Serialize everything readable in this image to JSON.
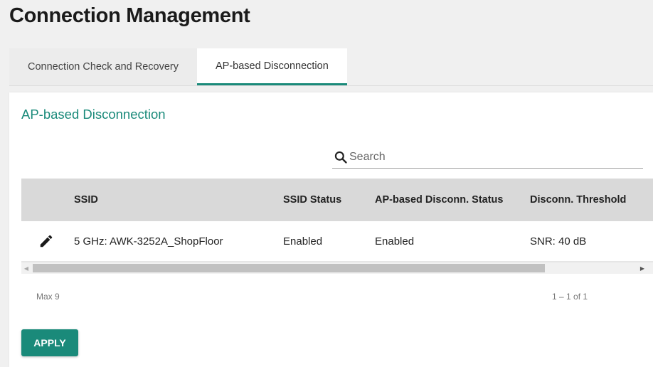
{
  "page": {
    "title": "Connection Management"
  },
  "tabs": [
    {
      "label": "Connection Check and Recovery",
      "active": false
    },
    {
      "label": "AP-based Disconnection",
      "active": true
    }
  ],
  "section": {
    "title": "AP-based Disconnection"
  },
  "search": {
    "placeholder": "Search",
    "icon": "search-icon"
  },
  "table": {
    "columns": [
      "",
      "SSID",
      "SSID Status",
      "AP-based Disconn. Status",
      "Disconn. Threshold"
    ],
    "rows": [
      {
        "edit_icon": "pencil-icon",
        "ssid": "5 GHz: AWK-3252A_ShopFloor",
        "ssid_status": "Enabled",
        "ap_status": "Enabled",
        "threshold": "SNR: 40 dB"
      }
    ]
  },
  "footer": {
    "max_label": "Max 9",
    "range_label": "1 – 1 of 1"
  },
  "actions": {
    "apply_label": "APPLY"
  },
  "colors": {
    "accent": "#1a8a7a",
    "header_bg": "#d9d9d9",
    "page_bg": "#f0f0f0"
  }
}
